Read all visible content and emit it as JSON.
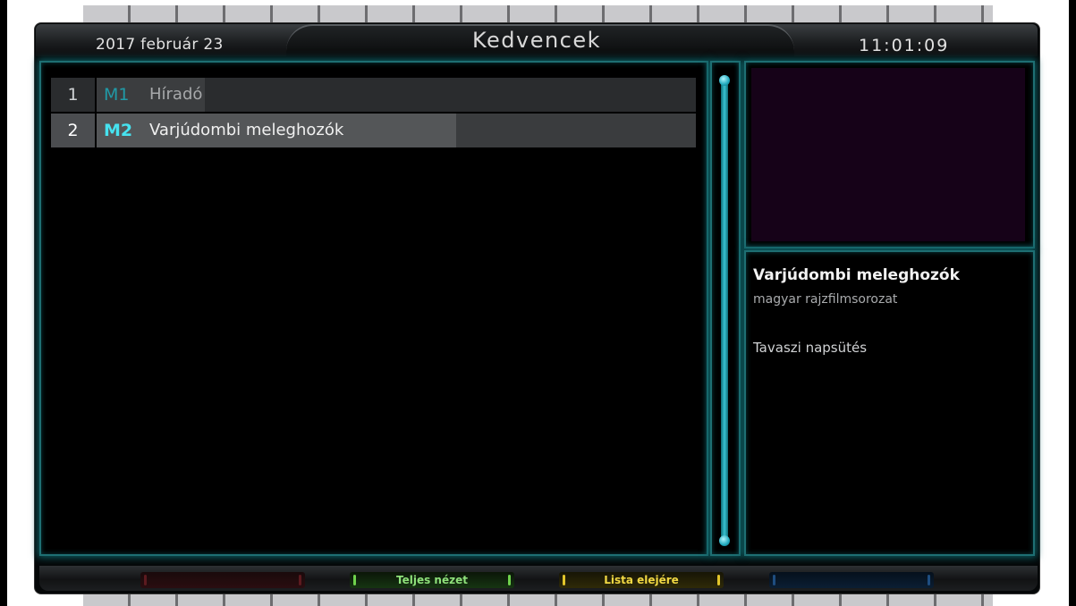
{
  "header": {
    "date": "2017 február 23",
    "title": "Kedvencek",
    "clock": "11:01:09"
  },
  "channels": [
    {
      "number": "1",
      "code": "M1",
      "name": "Híradó",
      "progress": 0.18
    },
    {
      "number": "2",
      "code": "M2",
      "name": "Varjúdombi meleghozók",
      "progress": 0.6
    }
  ],
  "selected_index": 1,
  "info": {
    "title": "Varjúdombi meleghozók",
    "subtitle": "magyar rajzfilmsorozat",
    "next_program": "Tavaszi napsütés"
  },
  "footer": {
    "red_label": "",
    "green_label": "Teljes nézet",
    "yellow_label": "Lista elejére",
    "blue_label": ""
  },
  "colors": {
    "accent_cyan": "#46e2ef",
    "panel_border": "#1e6f73",
    "preview_background": "#160218",
    "green_key": "#6fd24c",
    "yellow_key": "#e2c52a"
  }
}
